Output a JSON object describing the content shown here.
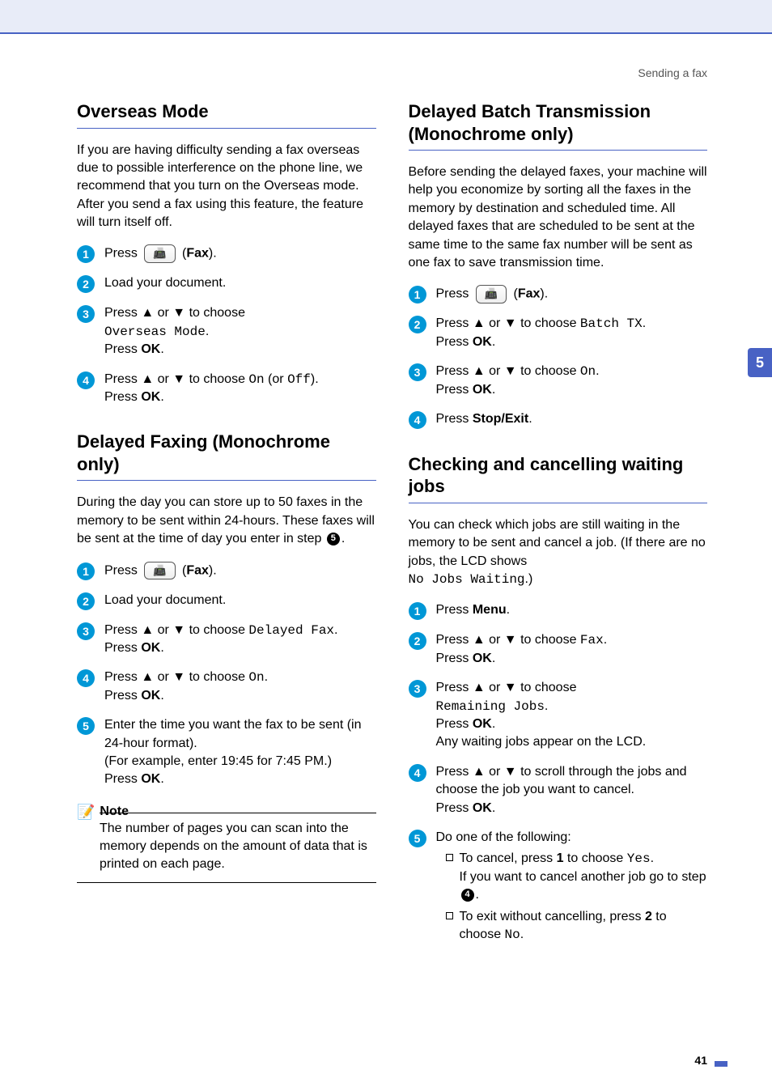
{
  "header": {
    "breadcrumb": "Sending a fax"
  },
  "side_tab": "5",
  "page_number": "41",
  "left": {
    "sec1": {
      "title": "Overseas Mode",
      "intro": "If you are having difficulty sending a fax overseas due to possible interference on the phone line, we recommend that you turn on the Overseas mode. After you send a fax using this feature, the feature will turn itself off.",
      "steps": {
        "s1_a": "Press ",
        "s1_b": " (",
        "s1_c": "Fax",
        "s1_d": ").",
        "s2": "Load your document.",
        "s3_a": "Press ▲ or ▼ to choose ",
        "s3_code": "Overseas Mode",
        "s3_b": ".",
        "s3_c": "Press ",
        "s3_d": "OK",
        "s3_e": ".",
        "s4_a": "Press ▲ or ▼ to choose ",
        "s4_code1": "On",
        "s4_b": " (or ",
        "s4_code2": "Off",
        "s4_c": ").",
        "s4_d": "Press ",
        "s4_e": "OK",
        "s4_f": "."
      }
    },
    "sec2": {
      "title": "Delayed Faxing (Monochrome only)",
      "intro_a": "During the day you can store up to 50 faxes in the memory to be sent within 24-hours. These faxes will be sent at the time of day you enter in step ",
      "intro_ref": "5",
      "intro_b": ".",
      "steps": {
        "s1_a": "Press ",
        "s1_b": " (",
        "s1_c": "Fax",
        "s1_d": ").",
        "s2": "Load your document.",
        "s3_a": "Press ▲ or ▼ to choose ",
        "s3_code": "Delayed Fax",
        "s3_b": ".",
        "s3_c": "Press ",
        "s3_d": "OK",
        "s3_e": ".",
        "s4_a": "Press ▲ or ▼ to choose ",
        "s4_code": "On",
        "s4_b": ".",
        "s4_c": "Press ",
        "s4_d": "OK",
        "s4_e": ".",
        "s5_a": "Enter the time you want the fax to be sent (in 24-hour format).",
        "s5_b": "(For example, enter 19:45 for 7:45 PM.)",
        "s5_c": "Press ",
        "s5_d": "OK",
        "s5_e": "."
      },
      "note": {
        "label": "Note",
        "body": "The number of pages you can scan into the memory depends on the amount of data that is printed on each page."
      }
    }
  },
  "right": {
    "sec1": {
      "title": "Delayed Batch Transmission (Monochrome only)",
      "intro": "Before sending the delayed faxes, your machine will help you economize by sorting all the faxes in the memory by destination and scheduled time. All delayed faxes that are scheduled to be sent at the same time to the same fax number will be sent as one fax to save transmission time.",
      "steps": {
        "s1_a": "Press ",
        "s1_b": " (",
        "s1_c": "Fax",
        "s1_d": ").",
        "s2_a": "Press ▲ or ▼ to choose ",
        "s2_code": "Batch TX",
        "s2_b": ".",
        "s2_c": "Press ",
        "s2_d": "OK",
        "s2_e": ".",
        "s3_a": "Press ▲ or ▼ to choose ",
        "s3_code": "On",
        "s3_b": ".",
        "s3_c": "Press ",
        "s3_d": "OK",
        "s3_e": ".",
        "s4_a": "Press ",
        "s4_b": "Stop/Exit",
        "s4_c": "."
      }
    },
    "sec2": {
      "title": "Checking and cancelling waiting jobs",
      "intro_a": "You can check which jobs are still waiting in the memory to be sent and cancel a job. (If there are no jobs, the LCD shows ",
      "intro_code": "No Jobs Waiting",
      "intro_b": ".)",
      "steps": {
        "s1_a": "Press ",
        "s1_b": "Menu",
        "s1_c": ".",
        "s2_a": "Press ▲ or ▼ to choose ",
        "s2_code": "Fax",
        "s2_b": ".",
        "s2_c": "Press ",
        "s2_d": "OK",
        "s2_e": ".",
        "s3_a": "Press ▲ or ▼ to choose ",
        "s3_code": "Remaining Jobs",
        "s3_b": ".",
        "s3_c": "Press ",
        "s3_d": "OK",
        "s3_e": ".",
        "s3_f": "Any waiting jobs appear on the LCD.",
        "s4_a": "Press ▲ or ▼ to scroll through the jobs and choose the job you want to cancel.",
        "s4_b": "Press ",
        "s4_c": "OK",
        "s4_d": ".",
        "s5_a": "Do one of the following:",
        "s5_b1_a": "To cancel, press ",
        "s5_b1_b": "1",
        "s5_b1_c": " to choose ",
        "s5_b1_code": "Yes",
        "s5_b1_d": ".",
        "s5_b1_e": "If you want to cancel another job go to step ",
        "s5_b1_ref": "4",
        "s5_b1_f": ".",
        "s5_b2_a": "To exit without cancelling, press ",
        "s5_b2_b": "2",
        "s5_b2_c": " to choose ",
        "s5_b2_code": "No",
        "s5_b2_d": "."
      }
    }
  },
  "icons": {
    "fax_btn": "📠"
  }
}
